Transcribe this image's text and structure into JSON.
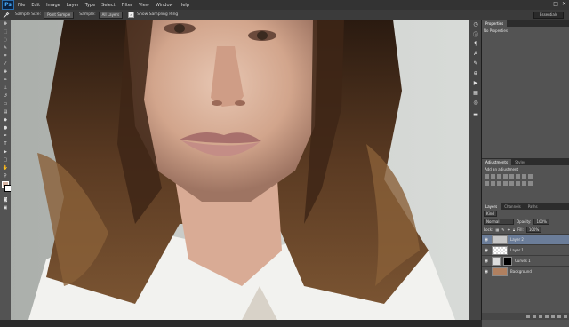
{
  "app": {
    "logo": "Ps"
  },
  "menu": [
    "File",
    "Edit",
    "Image",
    "Layer",
    "Type",
    "Select",
    "Filter",
    "View",
    "Window",
    "Help"
  ],
  "options": {
    "sample_size_label": "Sample Size:",
    "sample_size_value": "Point Sample",
    "sample_label": "Sample:",
    "sample_value": "All Layers",
    "show_ring_label": "Show Sampling Ring",
    "workspace": "Essentials"
  },
  "properties": {
    "tabs": [
      "Properties"
    ],
    "empty": "No Properties"
  },
  "adjustments": {
    "tabs": [
      "Adjustments",
      "Styles"
    ],
    "hint": "Add an adjustment"
  },
  "layers_panel": {
    "tabs": [
      "Layers",
      "Channels",
      "Paths"
    ],
    "filter": "Kind",
    "blend_mode": "Normal",
    "opacity_label": "Opacity:",
    "opacity": "100%",
    "lock_label": "Lock:",
    "fill_label": "Fill:",
    "fill": "100%",
    "layers": [
      {
        "name": "Layer 2",
        "selected": true,
        "thumb": "#c7c7c7"
      },
      {
        "name": "Layer 1",
        "selected": false,
        "thumb": ""
      },
      {
        "name": "Curves 1",
        "selected": false,
        "thumb": "#000000"
      },
      {
        "name": "Background",
        "selected": false,
        "thumb": "#b08060"
      }
    ]
  },
  "colors": {
    "selection": "#6b7d99",
    "panel": "#535353"
  }
}
